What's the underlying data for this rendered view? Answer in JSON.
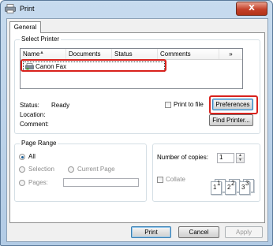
{
  "window": {
    "title": "Print",
    "close_label": "X"
  },
  "tabs": [
    {
      "label": "General"
    }
  ],
  "select_printer": {
    "group_label": "Select Printer",
    "columns": [
      "Name",
      "Documents",
      "Status",
      "Comments",
      "»"
    ],
    "printers": [
      {
        "name": "Canon Fax"
      }
    ],
    "status_label": "Status:",
    "status_value": "Ready",
    "location_label": "Location:",
    "location_value": "",
    "comment_label": "Comment:",
    "comment_value": "",
    "print_to_file_label": "Print to file",
    "print_to_file_checked": false,
    "preferences_label": "Preferences",
    "find_printer_label": "Find Printer..."
  },
  "page_range": {
    "group_label": "Page Range",
    "options": {
      "all": "All",
      "selection": "Selection",
      "current_page": "Current Page",
      "pages": "Pages:"
    },
    "selected": "all",
    "pages_value": ""
  },
  "copies": {
    "label": "Number of copies:",
    "value": "1",
    "collate_label": "Collate",
    "collate_checked": false,
    "collate_pages": [
      "1",
      "1",
      "2",
      "2",
      "3",
      "3"
    ]
  },
  "buttons": {
    "print": "Print",
    "cancel": "Cancel",
    "apply": "Apply"
  },
  "colors": {
    "highlight": "#d9211c",
    "title_bar": "#b9d1ea",
    "close_button": "#c4412a"
  }
}
